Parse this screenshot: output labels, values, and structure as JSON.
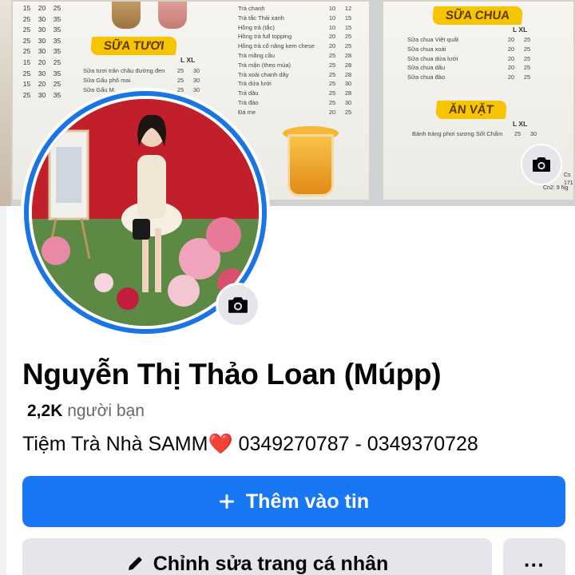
{
  "cover": {
    "board_left": {
      "price_rows": [
        [
          "15",
          "20",
          "25"
        ],
        [
          "25",
          "30",
          "35"
        ],
        [
          "25",
          "30",
          "35"
        ],
        [
          "25",
          "30",
          "35"
        ],
        [
          "25",
          "30",
          "35"
        ],
        [
          "15",
          "20",
          "25"
        ],
        [
          "25",
          "30",
          "35"
        ],
        [
          "15",
          "20",
          "25"
        ],
        [
          "25",
          "30",
          "35"
        ]
      ],
      "milk_tea_banner": "SỮA TƯƠI",
      "milk_size_header": "L   XL",
      "milk_items": [
        {
          "name": "Sữa tươi trân châu đường đen",
          "l": "25",
          "xl": "30"
        },
        {
          "name": "Sữa Gấu phô mai",
          "l": "25",
          "xl": "30"
        },
        {
          "name": "Sữa Gấu M...",
          "l": "25",
          "xl": "30"
        }
      ],
      "tea_items": [
        {
          "name": "Trà chanh",
          "l": "10",
          "xl": "12"
        },
        {
          "name": "Trà tắc Thái xanh",
          "l": "10",
          "xl": "15"
        },
        {
          "name": "Hồng trà (tắc)",
          "l": "10",
          "xl": "15"
        },
        {
          "name": "Hồng trà full topping",
          "l": "20",
          "xl": "25"
        },
        {
          "name": "Hồng trà cổ năng kem chese",
          "l": "20",
          "xl": "25"
        },
        {
          "name": "Trà mãng cầu",
          "l": "25",
          "xl": "28"
        },
        {
          "name": "Trà mận (theo mùa)",
          "l": "25",
          "xl": "28"
        },
        {
          "name": "Trà xoài chanh dây",
          "l": "25",
          "xl": "28"
        },
        {
          "name": "Trà dứa lưới",
          "l": "25",
          "xl": "30"
        },
        {
          "name": "Trà dâu",
          "l": "25",
          "xl": "28"
        },
        {
          "name": "Trà đào",
          "l": "25",
          "xl": "30"
        },
        {
          "name": "Đá me",
          "l": "20",
          "xl": "25"
        }
      ]
    },
    "board_right": {
      "yogurt_banner": "SỮA CHUA",
      "yogurt_size_header": "L   XL",
      "yogurt_items": [
        {
          "name": "Sữa chua Việt quất",
          "l": "20",
          "xl": "25"
        },
        {
          "name": "Sữa chua xoài",
          "l": "20",
          "xl": "25"
        },
        {
          "name": "Sữa chua dứa lưới",
          "l": "20",
          "xl": "25"
        },
        {
          "name": "Sữa chua dâu",
          "l": "20",
          "xl": "25"
        },
        {
          "name": "Sữa chua đào",
          "l": "20",
          "xl": "25"
        }
      ],
      "snack_banner": "ĂN VẶT",
      "snack_size_header": "L   XL",
      "snack_items": [
        {
          "name": "Bánh tráng phơi sương Sốt Chấm",
          "l": "25",
          "xl": "30"
        }
      ],
      "address_lines": [
        "Cs",
        "171",
        "Cn2: 9 Ng"
      ]
    },
    "camera_icon": "camera-icon"
  },
  "profile": {
    "name": "Nguyễn Thị Thảo Loan (Múpp)",
    "friends_count": "2,2K",
    "friends_label": "người bạn",
    "bio_text": "Tiệm Trà Nhà SAMM",
    "bio_heart": "❤️",
    "bio_phones": " 0349270787 - 0349370728",
    "avatar_camera_icon": "camera-icon"
  },
  "actions": {
    "add_story_label": "Thêm vào tin",
    "add_story_icon": "plus-icon",
    "edit_profile_label": "Chỉnh sửa trang cá nhân",
    "edit_profile_icon": "pencil-icon",
    "more_label": "···"
  },
  "colors": {
    "accent": "#1877f2",
    "ring": "#1b74e4",
    "secondary_button": "#e4e6eb",
    "banner_yellow": "#f6c400"
  }
}
